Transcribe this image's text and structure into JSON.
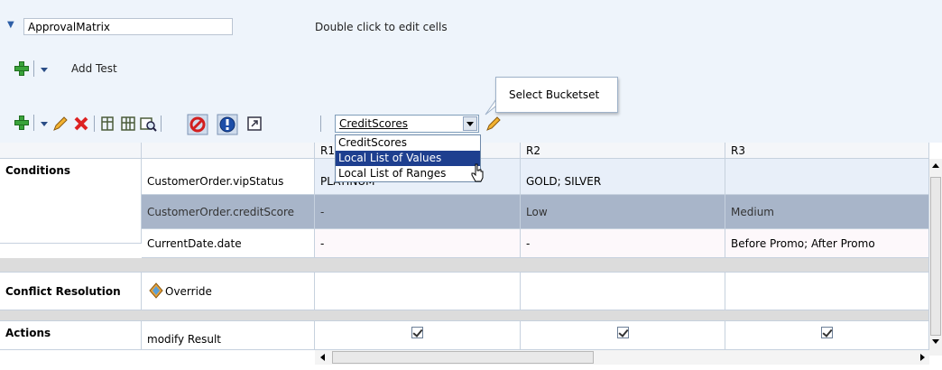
{
  "header": {
    "matrix_name": "ApprovalMatrix",
    "hint": "Double click to edit cells"
  },
  "test_toolbar": {
    "add_test_label": "Add Test"
  },
  "toolbar": {
    "bucketset_selected": "CreditScores",
    "tooltip": "Select Bucketset"
  },
  "bucketset_menu": {
    "options": [
      "CreditScores",
      "Local List of Values",
      "Local List of Ranges"
    ],
    "highlighted": "Local List of Values"
  },
  "table": {
    "columns": [
      "R1",
      "R2",
      "R3"
    ],
    "sections": {
      "conditions": "Conditions",
      "conflict": "Conflict Resolution",
      "actions": "Actions"
    },
    "rows": [
      {
        "label": "CustomerOrder.vipStatus",
        "values": [
          "PLATINUM",
          "GOLD; SILVER",
          ""
        ]
      },
      {
        "label": "CustomerOrder.creditScore",
        "values": [
          "-",
          "Low",
          "Medium"
        ]
      },
      {
        "label": "CurrentDate.date",
        "values": [
          "-",
          "-",
          "Before Promo; After Promo"
        ]
      }
    ],
    "conflict_value": "Override",
    "action_label": "modify Result",
    "action_checked": [
      true,
      true,
      true
    ]
  },
  "colors": {
    "selected_row": "#a8b5c9",
    "menu_highlight": "#1e3f8f",
    "panel_bg": "#eef4fb"
  }
}
